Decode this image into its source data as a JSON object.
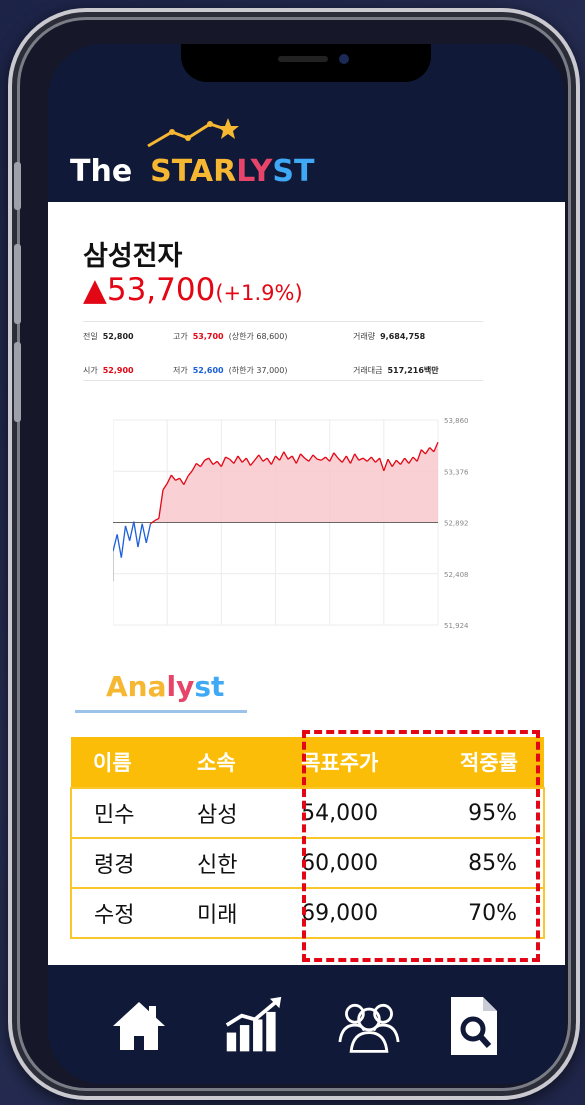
{
  "app": {
    "logo_the": "The",
    "logo_star": "STAR",
    "logo_ly": "LY",
    "logo_st": "ST"
  },
  "stock": {
    "name": "삼성전자",
    "price_arrow": "▲",
    "price": "53,700",
    "change": "(+1.9%)",
    "info": {
      "prev_label": "전일",
      "prev_value": "52,800",
      "high_label": "고가",
      "high_value": "53,700",
      "high_limit": "(상한가 68,600)",
      "volume_label": "거래량",
      "volume_value": "9,684,758",
      "open_label": "시가",
      "open_value": "52,900",
      "low_label": "저가",
      "low_value": "52,600",
      "low_limit": "(하한가 37,000)",
      "amount_label": "거래대금",
      "amount_value": "517,216백만"
    }
  },
  "chart_data": {
    "type": "line",
    "ylim": [
      51924,
      53860
    ],
    "y_ticks": [
      "53,860",
      "53,376",
      "52,892",
      "52,408",
      "51,924"
    ],
    "baseline": 52892,
    "colors": {
      "above": "#e30614",
      "below": "#1d5fd9",
      "fill": "#f8c8cd"
    },
    "values": [
      52620,
      52780,
      52560,
      52860,
      52720,
      52900,
      52660,
      52880,
      52700,
      52880,
      52910,
      52930,
      53200,
      53260,
      53340,
      53290,
      53310,
      53250,
      53330,
      53380,
      53450,
      53420,
      53480,
      53500,
      53440,
      53470,
      53420,
      53510,
      53490,
      53450,
      53520,
      53460,
      53500,
      53430,
      53480,
      53530,
      53470,
      53500,
      53440,
      53520,
      53480,
      53560,
      53490,
      53520,
      53450,
      53540,
      53500,
      53470,
      53530,
      53490,
      53480,
      53510,
      53470,
      53550,
      53500,
      53460,
      53520,
      53450,
      53540,
      53480,
      53500,
      53470,
      53510,
      53460,
      53500,
      53380,
      53490,
      53420,
      53480,
      53440,
      53500,
      53450,
      53510,
      53470,
      53580,
      53540,
      53600,
      53560,
      53650
    ]
  },
  "analyst": {
    "title_an": "An",
    "title_a": "a",
    "title_l": "l",
    "title_y": "y",
    "title_st": "st",
    "headers": [
      "이름",
      "소속",
      "목표주가",
      "적중률"
    ],
    "rows": [
      [
        "민수",
        "삼성",
        "54,000",
        "95%"
      ],
      [
        "령경",
        "신한",
        "60,000",
        "85%"
      ],
      [
        "수정",
        "미래",
        "69,000",
        "70%"
      ]
    ]
  },
  "nav": {
    "items": [
      "home-icon",
      "stock-chart-icon",
      "community-icon",
      "search-report-icon"
    ]
  }
}
